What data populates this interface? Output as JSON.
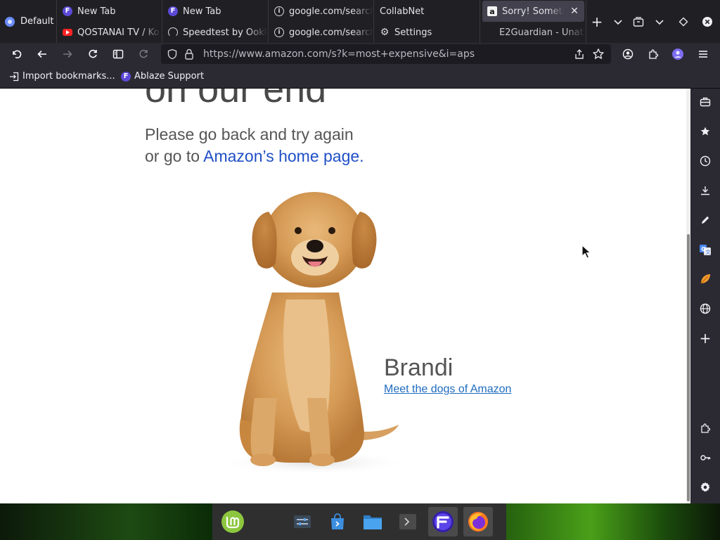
{
  "profile": {
    "label": "Default",
    "icon": "profile-icon"
  },
  "tabs": [
    {
      "top": {
        "title": "New Tab",
        "icon": "floorp-icon"
      },
      "bottom": {
        "title": "QOSTANAI TV / Ko",
        "icon": "youtube-icon"
      }
    },
    {
      "top": {
        "title": "New Tab",
        "icon": "floorp-icon"
      },
      "bottom": {
        "title": "Speedtest by Ookla",
        "icon": "speedtest-icon"
      }
    },
    {
      "top": {
        "title": "google.com/search",
        "icon": "info-icon"
      },
      "bottom": {
        "title": "google.com/search",
        "icon": "info-icon"
      }
    },
    {
      "top": {
        "title": "CollabNet",
        "icon": ""
      },
      "bottom": {
        "title": "Settings",
        "icon": "gear-icon"
      }
    },
    {
      "top": {
        "title": "Sorry! Something",
        "icon": "amazon-icon",
        "active": true
      },
      "bottom": {
        "title": "E2Guardian - Unat",
        "icon": ""
      }
    }
  ],
  "navbar": {
    "url": "https://www.amazon.com/s?k=most+expensive&i=aps"
  },
  "bookmarks": [
    {
      "label": "Import bookmarks...",
      "icon": "import-icon"
    },
    {
      "label": "Ablaze Support",
      "icon": "floorp-icon"
    }
  ],
  "page": {
    "heading_clipped": "on our end",
    "line1": "Please go back and try again",
    "line2_prefix": "or go to ",
    "home_link": "Amazon’s home page.",
    "dog_name": "Brandi",
    "dog_link": "Meet the dogs of Amazon"
  },
  "colors": {
    "link": "#1f4fc6",
    "dog_link": "#1f6cbf",
    "chrome_dark": "#2b2a33",
    "tabstrip": "#202024"
  }
}
